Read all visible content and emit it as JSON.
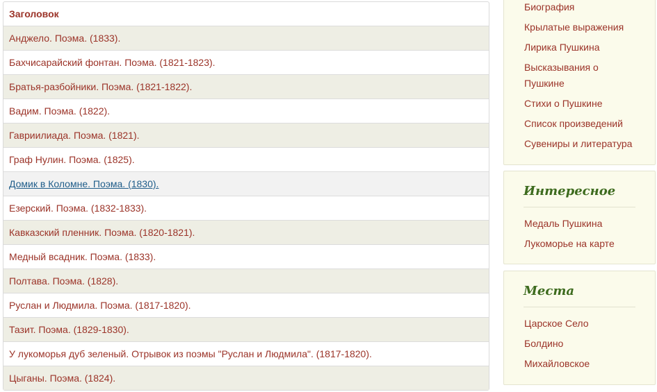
{
  "table": {
    "header": "Заголовок",
    "rows": [
      "Анджело. Поэма. (1833).",
      "Бахчисарайский фонтан. Поэма. (1821-1823).",
      "Братья-разбойники. Поэма. (1821-1822).",
      "Вадим. Поэма. (1822).",
      "Гавриилиада. Поэма. (1821).",
      "Граф Нулин. Поэма. (1825).",
      "Домик в Коломне. Поэма. (1830).",
      "Езерский. Поэма. (1832-1833).",
      "Кавказский пленник. Поэма. (1820-1821).",
      "Медный всадник. Поэма. (1833).",
      "Полтава. Поэма. (1828).",
      "Руслан и Людмила. Поэма. (1817-1820).",
      "Тазит. Поэма. (1829-1830).",
      "У лукоморья дуб зеленый. Отрывок из поэмы \"Руслан и Людмила\". (1817-1820).",
      "Цыганы. Поэма. (1824)."
    ]
  },
  "sidebar": {
    "panel1": {
      "items": [
        "Биография",
        "Крылатые выражения",
        "Лирика Пушкина",
        "Высказывания о",
        "Пушкине",
        "Стихи о Пушкине",
        "Список произведений",
        "Сувениры и литература"
      ]
    },
    "panel2": {
      "title": "Интересное",
      "items": [
        "Медаль Пушкина",
        "Лукоморье на карте"
      ]
    },
    "panel3": {
      "title": "Места",
      "items": [
        "Царское Село",
        "Болдино",
        "Михайловское"
      ]
    }
  },
  "colors": {
    "link": "#9b3328",
    "link_hover": "#1f5d8a",
    "panel_title": "#3d6b1e",
    "stripe": "#eeeee4",
    "panel_bg": "#fbfbeb"
  }
}
